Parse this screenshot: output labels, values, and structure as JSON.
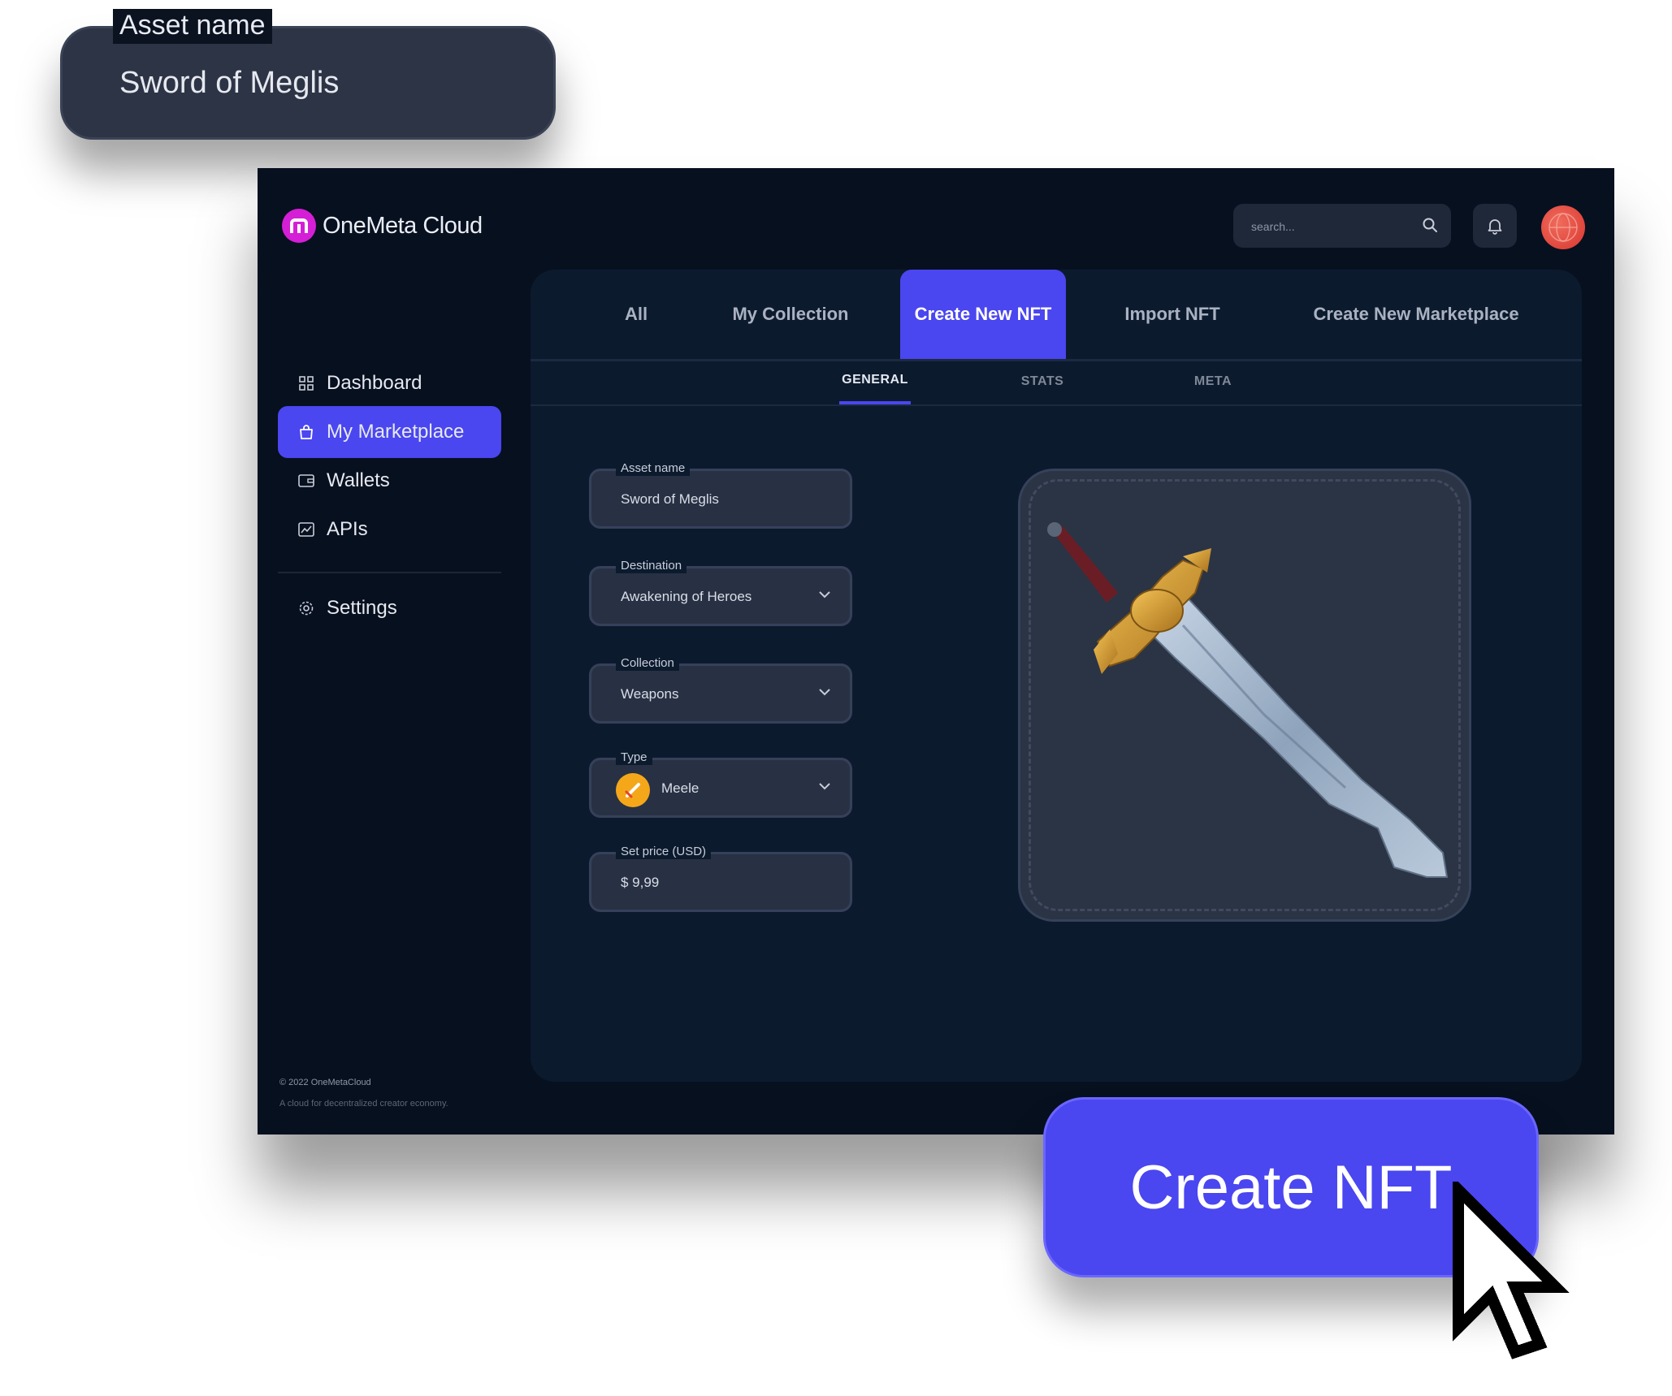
{
  "floating_field": {
    "label": "Asset name",
    "value": "Sword of Meglis"
  },
  "app": {
    "brand": "OneMeta Cloud"
  },
  "header": {
    "search_placeholder": "search..."
  },
  "sidebar": {
    "items": [
      {
        "label": "Dashboard",
        "icon": "grid-icon"
      },
      {
        "label": "My Marketplace",
        "icon": "bag-icon",
        "active": true
      },
      {
        "label": "Wallets",
        "icon": "wallet-icon"
      },
      {
        "label": "APIs",
        "icon": "chart-icon"
      }
    ],
    "settings": {
      "label": "Settings",
      "icon": "gear-icon"
    }
  },
  "footer": {
    "copyright": "© 2022 OneMetaCloud",
    "tagline": "A cloud for decentralized creator economy."
  },
  "tabs": [
    "All",
    "My Collection",
    "Create New NFT",
    "Import NFT",
    "Create New Marketplace"
  ],
  "active_tab": "Create New NFT",
  "subtabs": [
    "GENERAL",
    "STATS",
    "META"
  ],
  "active_subtab": "GENERAL",
  "form": {
    "asset_name": {
      "label": "Asset name",
      "value": "Sword of Meglis"
    },
    "destination": {
      "label": "Destination",
      "value": "Awakening of Heroes"
    },
    "collection": {
      "label": "Collection",
      "value": "Weapons"
    },
    "type": {
      "label": "Type",
      "value": "Meele"
    },
    "price": {
      "label": "Set price (USD)",
      "value": "$ 9,99"
    }
  },
  "create_button": {
    "label": "Create NFT"
  },
  "colors": {
    "accent": "#4a46f0",
    "background": "#07101f",
    "panel": "#0c1a2e",
    "brand_mark": "#d41fd6"
  }
}
